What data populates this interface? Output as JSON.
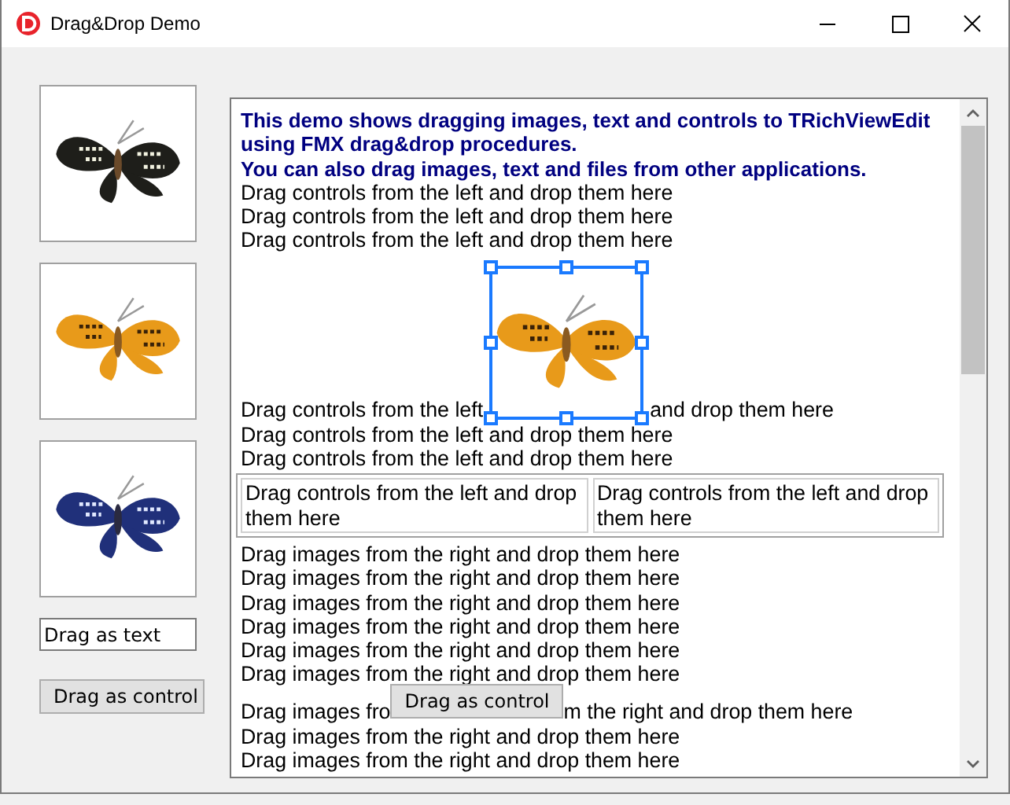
{
  "window": {
    "title": "Drag&Drop Demo"
  },
  "left_panel": {
    "images": [
      {
        "kind": "dark"
      },
      {
        "kind": "orange"
      },
      {
        "kind": "blue"
      }
    ],
    "text_field": {
      "value": "Drag as text"
    },
    "button": {
      "label": "Drag as control"
    }
  },
  "editor": {
    "blocks": [
      {
        "kind": "heading",
        "text": "This demo shows dragging images, text and controls to TRichViewEdit using FMX drag&drop procedures.\nYou can also drag images, text and files from other applications."
      },
      {
        "kind": "line",
        "text": "Drag controls from the left and drop them here"
      },
      {
        "kind": "line",
        "text": "Drag controls from the left and drop them here"
      },
      {
        "kind": "line",
        "text": "Drag controls from the left and drop them here"
      },
      {
        "kind": "image_line",
        "before": "Drag controls from the left ",
        "after": "and drop them here",
        "image": {
          "kind": "orange",
          "selected": true
        }
      },
      {
        "kind": "line",
        "text": "Drag controls from the left and drop them here"
      },
      {
        "kind": "line",
        "text": "Drag controls from the left and drop them here"
      },
      {
        "kind": "table",
        "cells": [
          "Drag controls from the left and drop them here",
          "Drag controls from the left and drop them here"
        ]
      },
      {
        "kind": "line",
        "text": "Drag images from the right and drop them here"
      },
      {
        "kind": "line",
        "text": "Drag images from the right and drop them here"
      },
      {
        "kind": "line",
        "text": "Drag images from the right and drop them here"
      },
      {
        "kind": "line",
        "text": "Drag images from the right and drop them here"
      },
      {
        "kind": "line",
        "text": "Drag images from the right and drop them here"
      },
      {
        "kind": "line",
        "text": "Drag images from the right and drop them here"
      },
      {
        "kind": "control_line",
        "before": "Drag images fro",
        "after": "m the right and drop them here",
        "button": "Drag as control"
      },
      {
        "kind": "line",
        "text": "Drag images from the right and drop them here"
      },
      {
        "kind": "line",
        "text": "Drag images from the right and drop them here"
      }
    ]
  }
}
